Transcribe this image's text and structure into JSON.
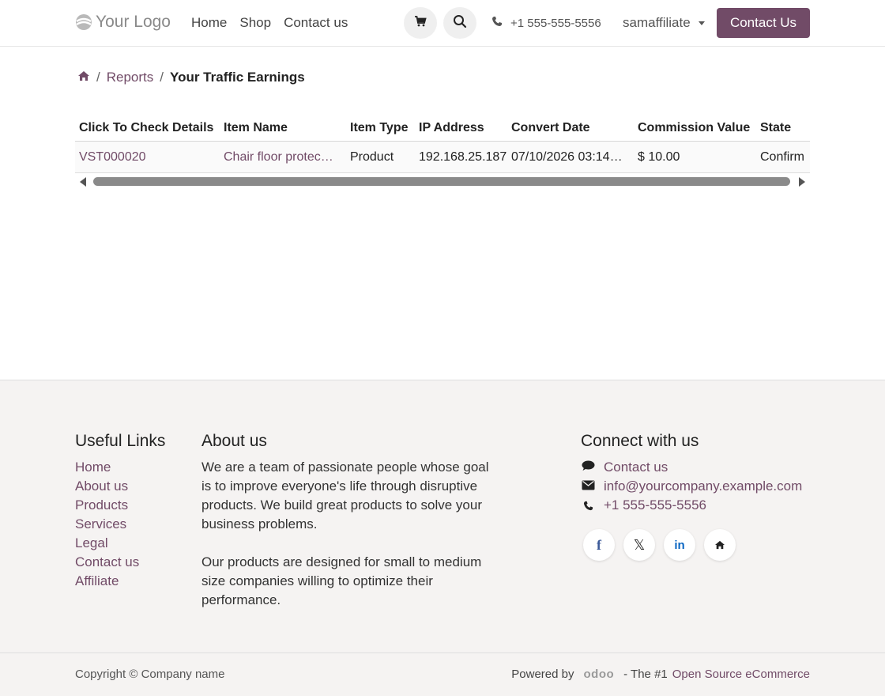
{
  "header": {
    "logo_text": "Your Logo",
    "nav": [
      "Home",
      "Shop",
      "Contact us"
    ],
    "phone": "+1 555-555-5556",
    "user": "samaffiliate",
    "cta_label": "Contact Us"
  },
  "breadcrumb": {
    "items": [
      "Reports"
    ],
    "current": "Your Traffic Earnings"
  },
  "table": {
    "columns": [
      "Click To Check Details",
      "Item Name",
      "Item Type",
      "IP Address",
      "Convert Date",
      "Commission Value",
      "State"
    ],
    "rows": [
      {
        "details": "VST000020",
        "item_name": "Chair floor protec…",
        "item_type": "Product",
        "ip": "192.168.25.187",
        "date": "07/10/2026 03:14…",
        "commission": "$ 10.00",
        "state": "Confirm"
      }
    ]
  },
  "footer": {
    "useful_links_title": "Useful Links",
    "useful_links": [
      "Home",
      "About us",
      "Products",
      "Services",
      "Legal",
      "Contact us",
      "Affiliate"
    ],
    "about_title": "About us",
    "about_p1": "We are a team of passionate people whose goal is to improve everyone's life through disruptive products. We build great products to solve your business problems.",
    "about_p2": "Our products are designed for small to medium size companies willing to optimize their performance.",
    "connect_title": "Connect with us",
    "connect_contact": "Contact us",
    "connect_email": "info@yourcompany.example.com",
    "connect_phone": "+1 555-555-5556",
    "social": [
      "facebook",
      "x",
      "linkedin",
      "home"
    ],
    "copyright": "Copyright © Company name",
    "powered_by": "Powered by",
    "odoo": "odoo",
    "powered_suffix": "- The #1",
    "powered_link": "Open Source eCommerce"
  },
  "colors": {
    "accent": "#714b67",
    "footer_bg": "#f5f3f2"
  }
}
